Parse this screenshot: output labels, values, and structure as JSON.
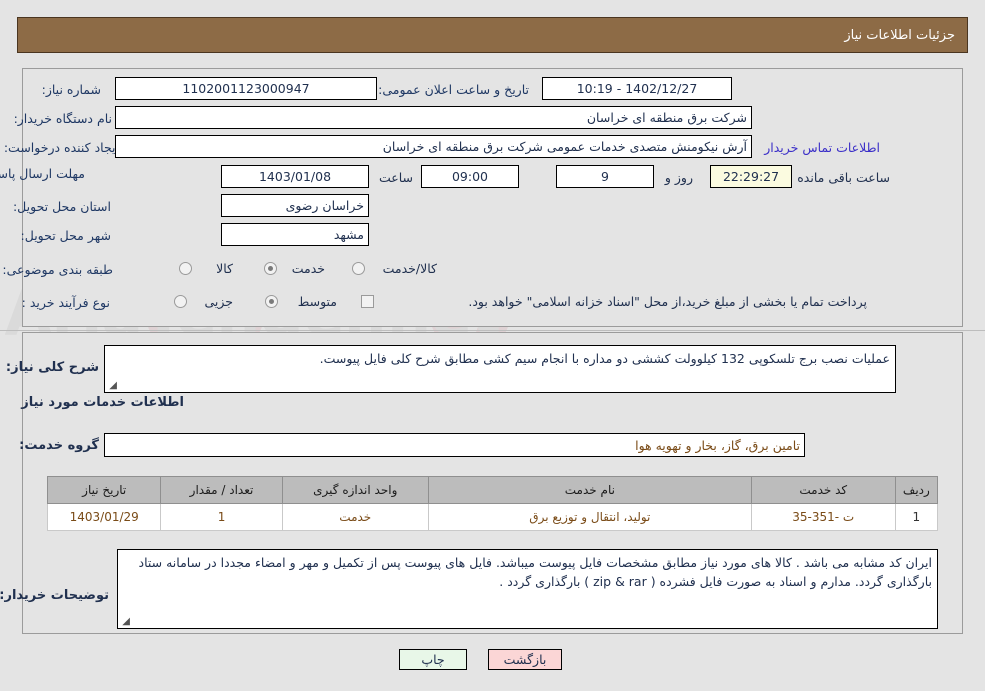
{
  "header": {
    "title": "جزئیات اطلاعات نیاز"
  },
  "form": {
    "need_number_label": "شماره نیاز:",
    "need_number_value": "1102001123000947",
    "announce_datetime_label": "تاریخ و ساعت اعلان عمومی:",
    "announce_datetime_value": "1402/12/27 - 10:19",
    "buyer_org_label": "نام دستگاه خریدار:",
    "buyer_org_value": "شرکت برق منطقه ای خراسان",
    "creator_label": "ایجاد کننده درخواست:",
    "creator_value": "آرش نیکومنش متصدی خدمات عمومی شرکت برق منطقه ای خراسان",
    "contact_link": "اطلاعات تماس خریدار",
    "deadline_label": "مهلت ارسال پاسخ: تا تاریخ:",
    "deadline_date": "1403/01/08",
    "hour_label": "ساعت",
    "deadline_time": "09:00",
    "days_value": "9",
    "days_unit": "روز و",
    "remaining_time": "22:29:27",
    "remaining_unit": "ساعت باقی مانده",
    "province_label": "استان محل تحویل:",
    "province_value": "خراسان رضوی",
    "city_label": "شهر محل تحویل:",
    "city_value": "مشهد",
    "category_label": "طبقه بندی موضوعی:",
    "category_options": [
      {
        "label": "کالا",
        "checked": false
      },
      {
        "label": "خدمت",
        "checked": true
      },
      {
        "label": "کالا/خدمت",
        "checked": false
      }
    ],
    "process_label": "نوع فرآیند خرید :",
    "process_options": [
      {
        "label": "جزیی",
        "checked": false
      },
      {
        "label": "متوسط",
        "checked": true
      }
    ],
    "treasury_checkbox_label": "پرداخت تمام یا بخشی از مبلغ خرید،از محل \"اسناد خزانه اسلامی\" خواهد بود.",
    "treasury_checked": false
  },
  "description": {
    "general_label": "شرح کلی نیاز:",
    "general_value": "عملیات نصب برج تلسکوپی 132 کیلوولت کششی دو مداره با انجام سیم کشی  مطابق شرح کلی فایل پیوست.",
    "services_heading": "اطلاعات خدمات مورد نیاز",
    "service_group_label": "گروه خدمت:",
    "service_group_value": "تامین برق، گاز، بخار و تهویه هوا"
  },
  "table": {
    "columns": [
      "ردیف",
      "کد خدمت",
      "نام خدمت",
      "واحد اندازه گیری",
      "تعداد / مقدار",
      "تاریخ نیاز"
    ],
    "rows": [
      {
        "index": "1",
        "service_code": "ت -351-35",
        "service_name": "تولید، انتقال و توزیع برق",
        "unit": "خدمت",
        "quantity": "1",
        "need_date": "1403/01/29"
      }
    ]
  },
  "buyer_notes": {
    "label": "توضیحات خریدار:",
    "value": "ایران کد مشابه می باشد . کالا های مورد نیاز مطابق مشخصات فایل پیوست میباشد. فایل های پیوست پس از تکمیل و مهر و امضاء مجددا در سامانه ستاد بارگذاری گردد. مدارم و اسناد به صورت فایل فشرده ( zip & rar ) بارگذاری گردد ."
  },
  "footer": {
    "print_label": "چاپ",
    "back_label": "بازگشت"
  },
  "watermark": {
    "text": "AriaTender.net"
  },
  "colors": {
    "header_bg": "#8d6b46",
    "page_bg": "#e4e4e4",
    "label_text": "#1f3864",
    "link_text": "#3b2fc8",
    "table_header_bg": "#bcbcbc",
    "table_cell_text": "#7a4b17",
    "print_btn_bg": "#e8f7e8",
    "back_btn_bg": "#fbd6d6",
    "highlight_field_bg": "#fbfbe0"
  }
}
